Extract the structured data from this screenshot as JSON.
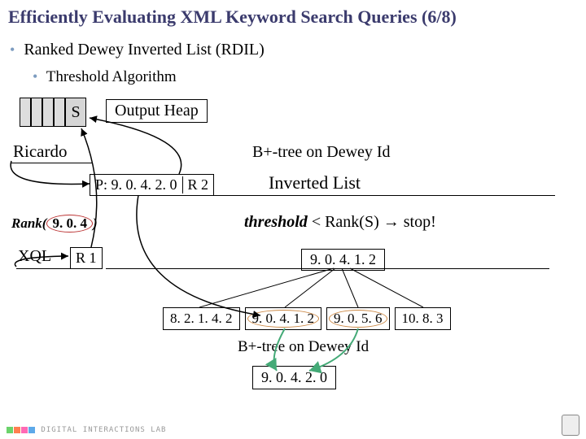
{
  "title": "Efficiently Evaluating XML Keyword Search Queries (6/8)",
  "bullets": {
    "b1": "Ranked Dewey Inverted List (RDIL)",
    "b2": "Threshold Algorithm"
  },
  "stack_top": "S",
  "output_heap": "Output Heap",
  "keywords": {
    "ricardo": "Ricardo",
    "xql": "XQL"
  },
  "btree_label_1": "B+-tree on Dewey Id",
  "btree_label_2": "B+-tree on Dewey Id",
  "inverted_list": "Inverted List",
  "p_box": {
    "prefix": "P: 9. 0. 4. 2. 0",
    "tag": "R 2"
  },
  "r1": "R 1",
  "rank_label": "Rank(",
  "rank_value": "9. 0. 4",
  "rank_close": ")",
  "threshold_text": {
    "a": "threshold",
    "b": " < Rank(S) ",
    "c": "→",
    "d": " stop!"
  },
  "mid_value": "9. 0. 4. 1. 2",
  "nodes": [
    "8. 2. 1. 4. 2",
    "9. 0. 4. 1. 2",
    "9. 0. 5. 6",
    "10. 8. 3"
  ],
  "node_highlight": [
    false,
    true,
    true,
    false
  ],
  "final_value": "9. 0. 4. 2. 0",
  "footer": "DIGITAL INTERACTIONS LAB",
  "footer_colors": [
    "#6bd36b",
    "#ff7f50",
    "#ff69b4",
    "#5da9e9"
  ]
}
